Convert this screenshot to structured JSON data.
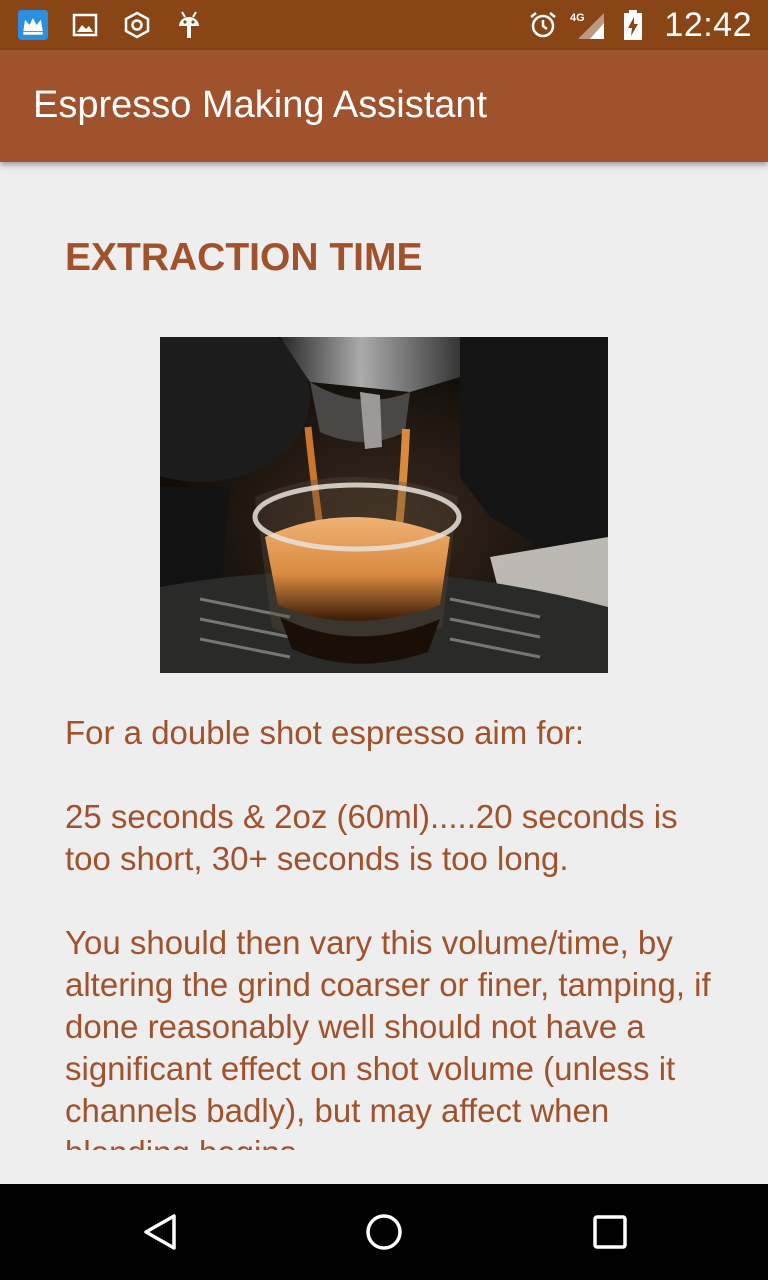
{
  "status_bar": {
    "notification_icons": [
      "crown-app-icon",
      "image-icon",
      "settings-hex-icon",
      "android-debug-icon"
    ],
    "system_icons": [
      "alarm-icon",
      "signal-4g-icon",
      "battery-charging-icon"
    ],
    "network_label": "4G",
    "time": "12:42"
  },
  "app_bar": {
    "title": "Espresso Making Assistant"
  },
  "content": {
    "heading": "EXTRACTION TIME",
    "paragraphs": [
      "For a double shot espresso aim for:",
      " 25 seconds & 2oz (60ml).....20 seconds is too short, 30+ seconds is too long.",
      " You should then vary this volume/time, by altering the grind coarser or finer, tamping, if done reasonably well should not have a significant effect on shot volume (unless it channels badly), but may affect when blonding begins."
    ]
  },
  "nav_bar": {
    "buttons": [
      "back-icon",
      "home-icon",
      "recents-icon"
    ]
  },
  "colors": {
    "status_bar": "#8a4516",
    "app_bar": "#a0522d",
    "accent_text": "#a0522d",
    "background": "#eeeeee"
  }
}
